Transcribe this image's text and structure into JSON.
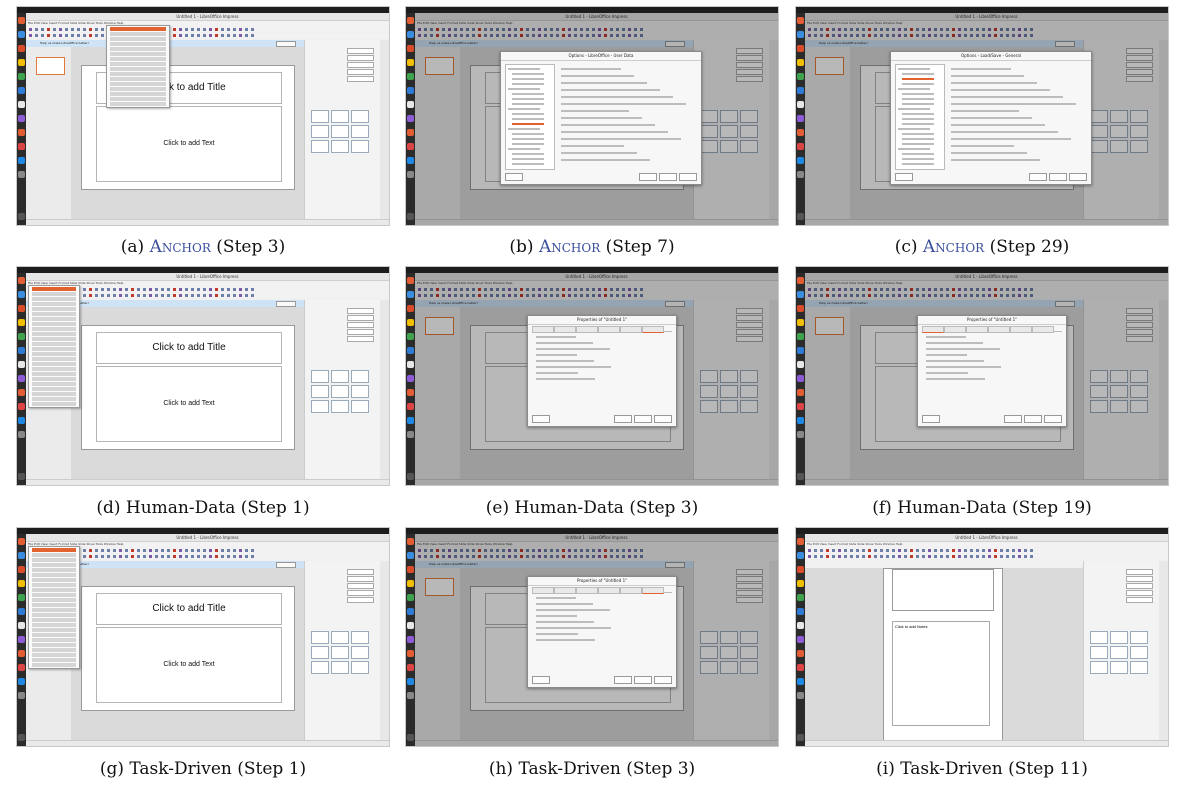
{
  "shared": {
    "window_title": "Untitled 1 - LibreOffice Impress",
    "title_placeholder": "Click to add Title",
    "text_placeholder": "Click to add Text",
    "notes_placeholder": "Click to add Notes",
    "infobar_text": "Help us make LibreOffice better!",
    "infobar_button": "Get Involved",
    "menus": [
      "File",
      "Edit",
      "View",
      "Insert",
      "Format",
      "Slide",
      "Slide Show",
      "Tools",
      "Window",
      "Help"
    ]
  },
  "panels": [
    {
      "id": "a",
      "caption_kw": "Anchor",
      "caption_rest": " (Step 3)",
      "letter": "(a) ",
      "variant": "tools-menu"
    },
    {
      "id": "b",
      "caption_kw": "Anchor",
      "caption_rest": " (Step 7)",
      "letter": "(b) ",
      "variant": "options-user-data",
      "dialog_title": "Options - LibreOffice - User Data"
    },
    {
      "id": "c",
      "caption_kw": "Anchor",
      "caption_rest": " (Step 29)",
      "letter": "(c) ",
      "variant": "options-general",
      "dialog_title": "Options - Load/Save - General"
    },
    {
      "id": "d",
      "caption_kw": "",
      "caption_rest": "Human-Data (Step 1)",
      "letter": "(d) ",
      "variant": "file-menu"
    },
    {
      "id": "e",
      "caption_kw": "",
      "caption_rest": "Human-Data (Step 3)",
      "letter": "(e) ",
      "variant": "properties-font",
      "dialog_title": "Properties of \"Untitled 1\""
    },
    {
      "id": "f",
      "caption_kw": "",
      "caption_rest": "Human-Data (Step 19)",
      "letter": "(f) ",
      "variant": "properties-general",
      "dialog_title": "Properties of \"Untitled 1\""
    },
    {
      "id": "g",
      "caption_kw": "",
      "caption_rest": "Task-Driven (Step 1)",
      "letter": "(g) ",
      "variant": "file-menu"
    },
    {
      "id": "h",
      "caption_kw": "",
      "caption_rest": "Task-Driven (Step 3)",
      "letter": "(h) ",
      "variant": "properties-font",
      "dialog_title": "Properties of \"Untitled 1\""
    },
    {
      "id": "i",
      "caption_kw": "",
      "caption_rest": "Task-Driven (Step 11)",
      "letter": "(i) ",
      "variant": "notes-view"
    }
  ],
  "colors": {
    "accent": "#e2632f",
    "anchor_caption": "#3a4f9e",
    "infobar": "#cfe3f7"
  }
}
